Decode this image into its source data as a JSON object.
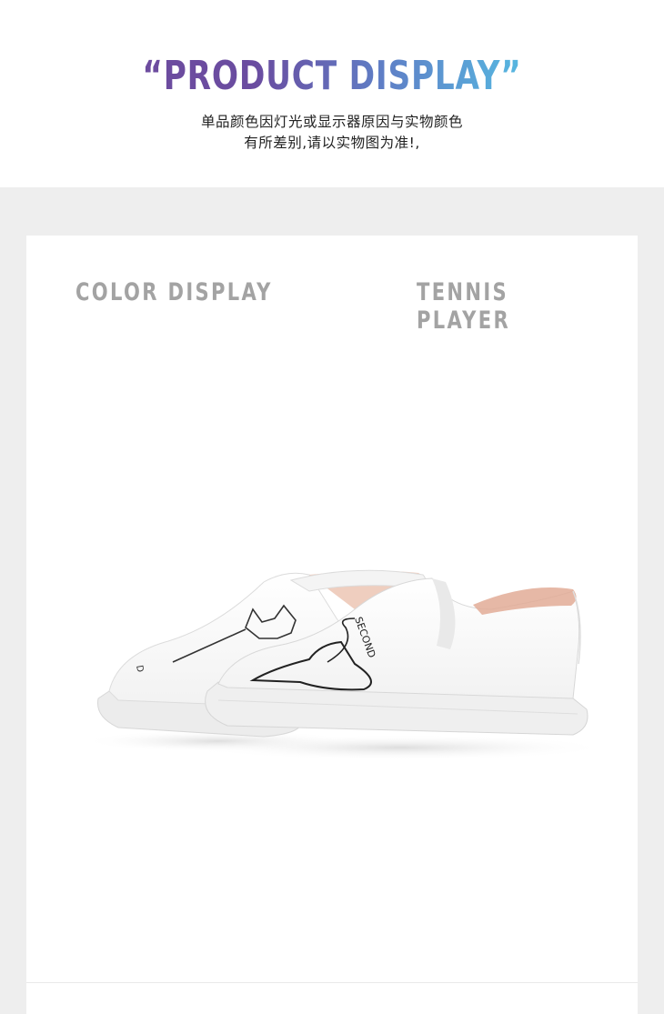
{
  "header": {
    "title": "“PRODUCT DISPLAY”",
    "subtitle_line1": "单品颜色因灯光或显示器原因与实物颜色",
    "subtitle_line2": "有所差别,请以实物图为准!,"
  },
  "panel": {
    "left_label": "COLOR DISPLAY",
    "right_label": "TENNIS PLAYER"
  },
  "colors": {
    "title_gradient_start": "#6f4c9e",
    "title_gradient_end": "#56c3e0",
    "label": "#a3a3a3",
    "background_band": "#eeeeee"
  }
}
